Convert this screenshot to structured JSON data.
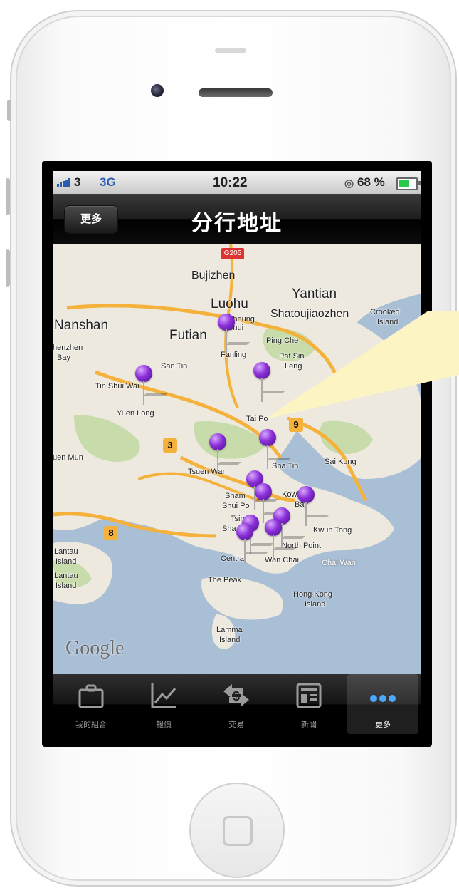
{
  "status_bar": {
    "carrier": "3",
    "network": "3G",
    "time": "10:22",
    "battery_percent": "68 %",
    "battery_level": 0.68
  },
  "nav_bar": {
    "back_label": "更多",
    "title": "分行地址"
  },
  "map": {
    "watermark": "Google",
    "road_shields": [
      "G205",
      "9",
      "3",
      "8"
    ],
    "place_labels": [
      "Bujizhen",
      "Yantian",
      "Luohu",
      "Shatoujiaozhen",
      "Crooked",
      "Island",
      "Nanshan",
      "Futian",
      "Sheung",
      "Shui",
      "Ping Che",
      "henzhen",
      "Bay",
      "Fanling",
      "Pat Sin",
      "Leng",
      "San Tin",
      "Tin Shui Wai",
      "Yuen Long",
      "Tai Po",
      "uen Mun",
      "Tsuen Wan",
      "Sha Tin",
      "Sai Kung",
      "Sham",
      "Shui Po",
      "Kowloon",
      "Bay",
      "Tsim",
      "Sha Tsui",
      "Kwun Tong",
      "North Point",
      "Lantau",
      "Island",
      "Central",
      "Wan Chai",
      "Chai Wan",
      "Lantau",
      "Island",
      "The Peak",
      "Hong Kong",
      "Island",
      "Lamma",
      "Island"
    ],
    "branch_pin_count": 12
  },
  "tab_bar": {
    "tabs": [
      {
        "label": "我的組合",
        "icon": "briefcase-icon"
      },
      {
        "label": "報價",
        "icon": "line-chart-icon"
      },
      {
        "label": "交易",
        "icon": "exchange-icon"
      },
      {
        "label": "新聞",
        "icon": "newspaper-icon"
      },
      {
        "label": "更多",
        "icon": "more-dots-icon"
      }
    ],
    "active_index": 4
  },
  "colors": {
    "pin": "#8a2fd8",
    "water": "#a9bfd6",
    "land": "#eee9df",
    "road": "#f4b23c",
    "park": "#c7dcaa",
    "callout": "#fdf4c4"
  }
}
